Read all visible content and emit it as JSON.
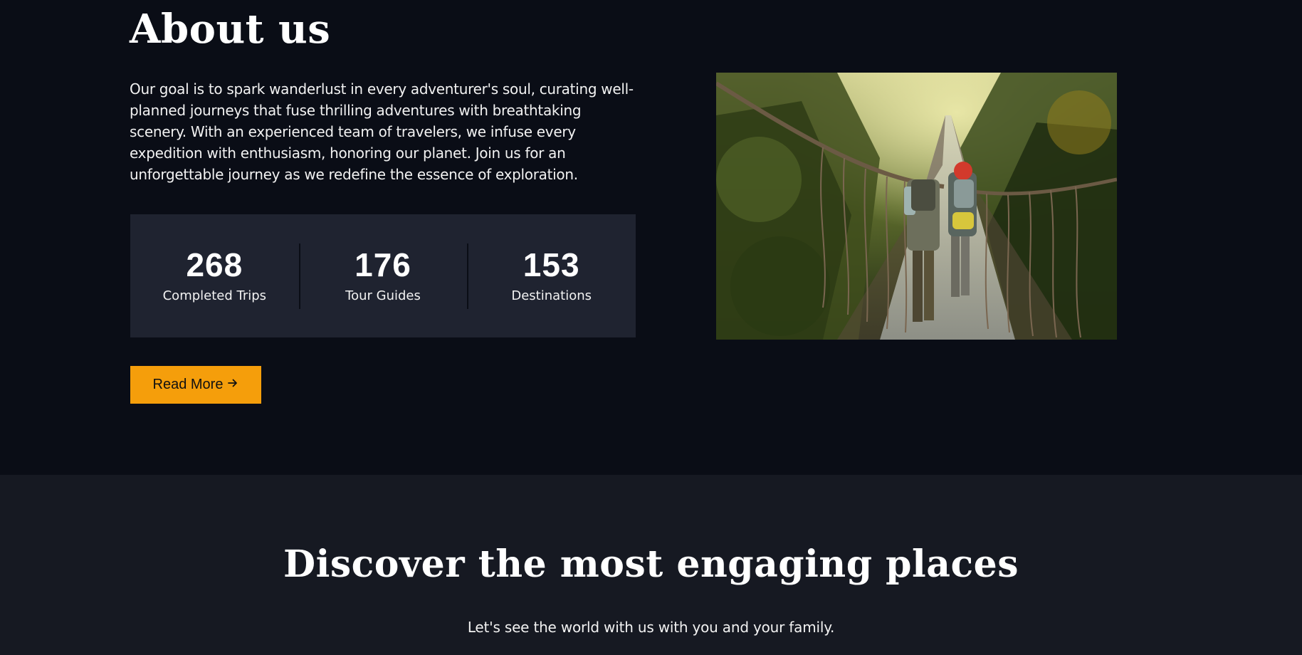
{
  "about": {
    "title": "About us",
    "description": "Our goal is to spark wanderlust in every adventurer's soul, curating well-planned journeys that fuse thrilling adventures with breathtaking scenery. With an experienced team of travelers, we infuse every expedition with enthusiasm, honoring our planet. Join us for an unforgettable journey as we redefine the essence of exploration.",
    "stats": [
      {
        "value": "268",
        "label": "Completed Trips"
      },
      {
        "value": "176",
        "label": "Tour Guides"
      },
      {
        "value": "153",
        "label": "Destinations"
      }
    ],
    "read_more_label": "Read More",
    "read_more_icon": "arrow-right-icon",
    "accent_color": "#f59e0b"
  },
  "discover": {
    "title": "Discover the most engaging places",
    "subtitle": "Let's see the world with us with you and your family."
  }
}
